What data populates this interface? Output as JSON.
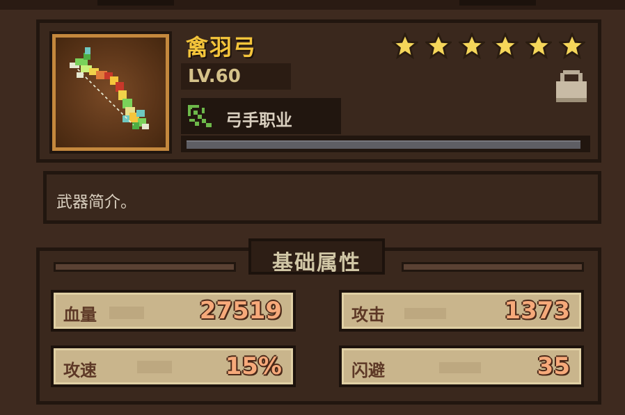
{
  "item": {
    "name": "禽羽弓",
    "level": "LV.60",
    "stars": 6,
    "class_label": "弓手职业",
    "xp_progress": 1.0
  },
  "description": "武器简介。",
  "stats_panel": {
    "title": "基础属性",
    "stats": [
      {
        "label": "血量",
        "value": "27519"
      },
      {
        "label": "攻击",
        "value": "1373"
      },
      {
        "label": "攻速",
        "value": "15%"
      },
      {
        "label": "闪避",
        "value": "35"
      }
    ]
  },
  "colors": {
    "name": "#f5c53b",
    "stat_value": "#f6a97a",
    "frame_gold": "#c4883d"
  },
  "icons": [
    "bow-icon",
    "star-icon",
    "lock-icon",
    "bow-class-icon"
  ]
}
